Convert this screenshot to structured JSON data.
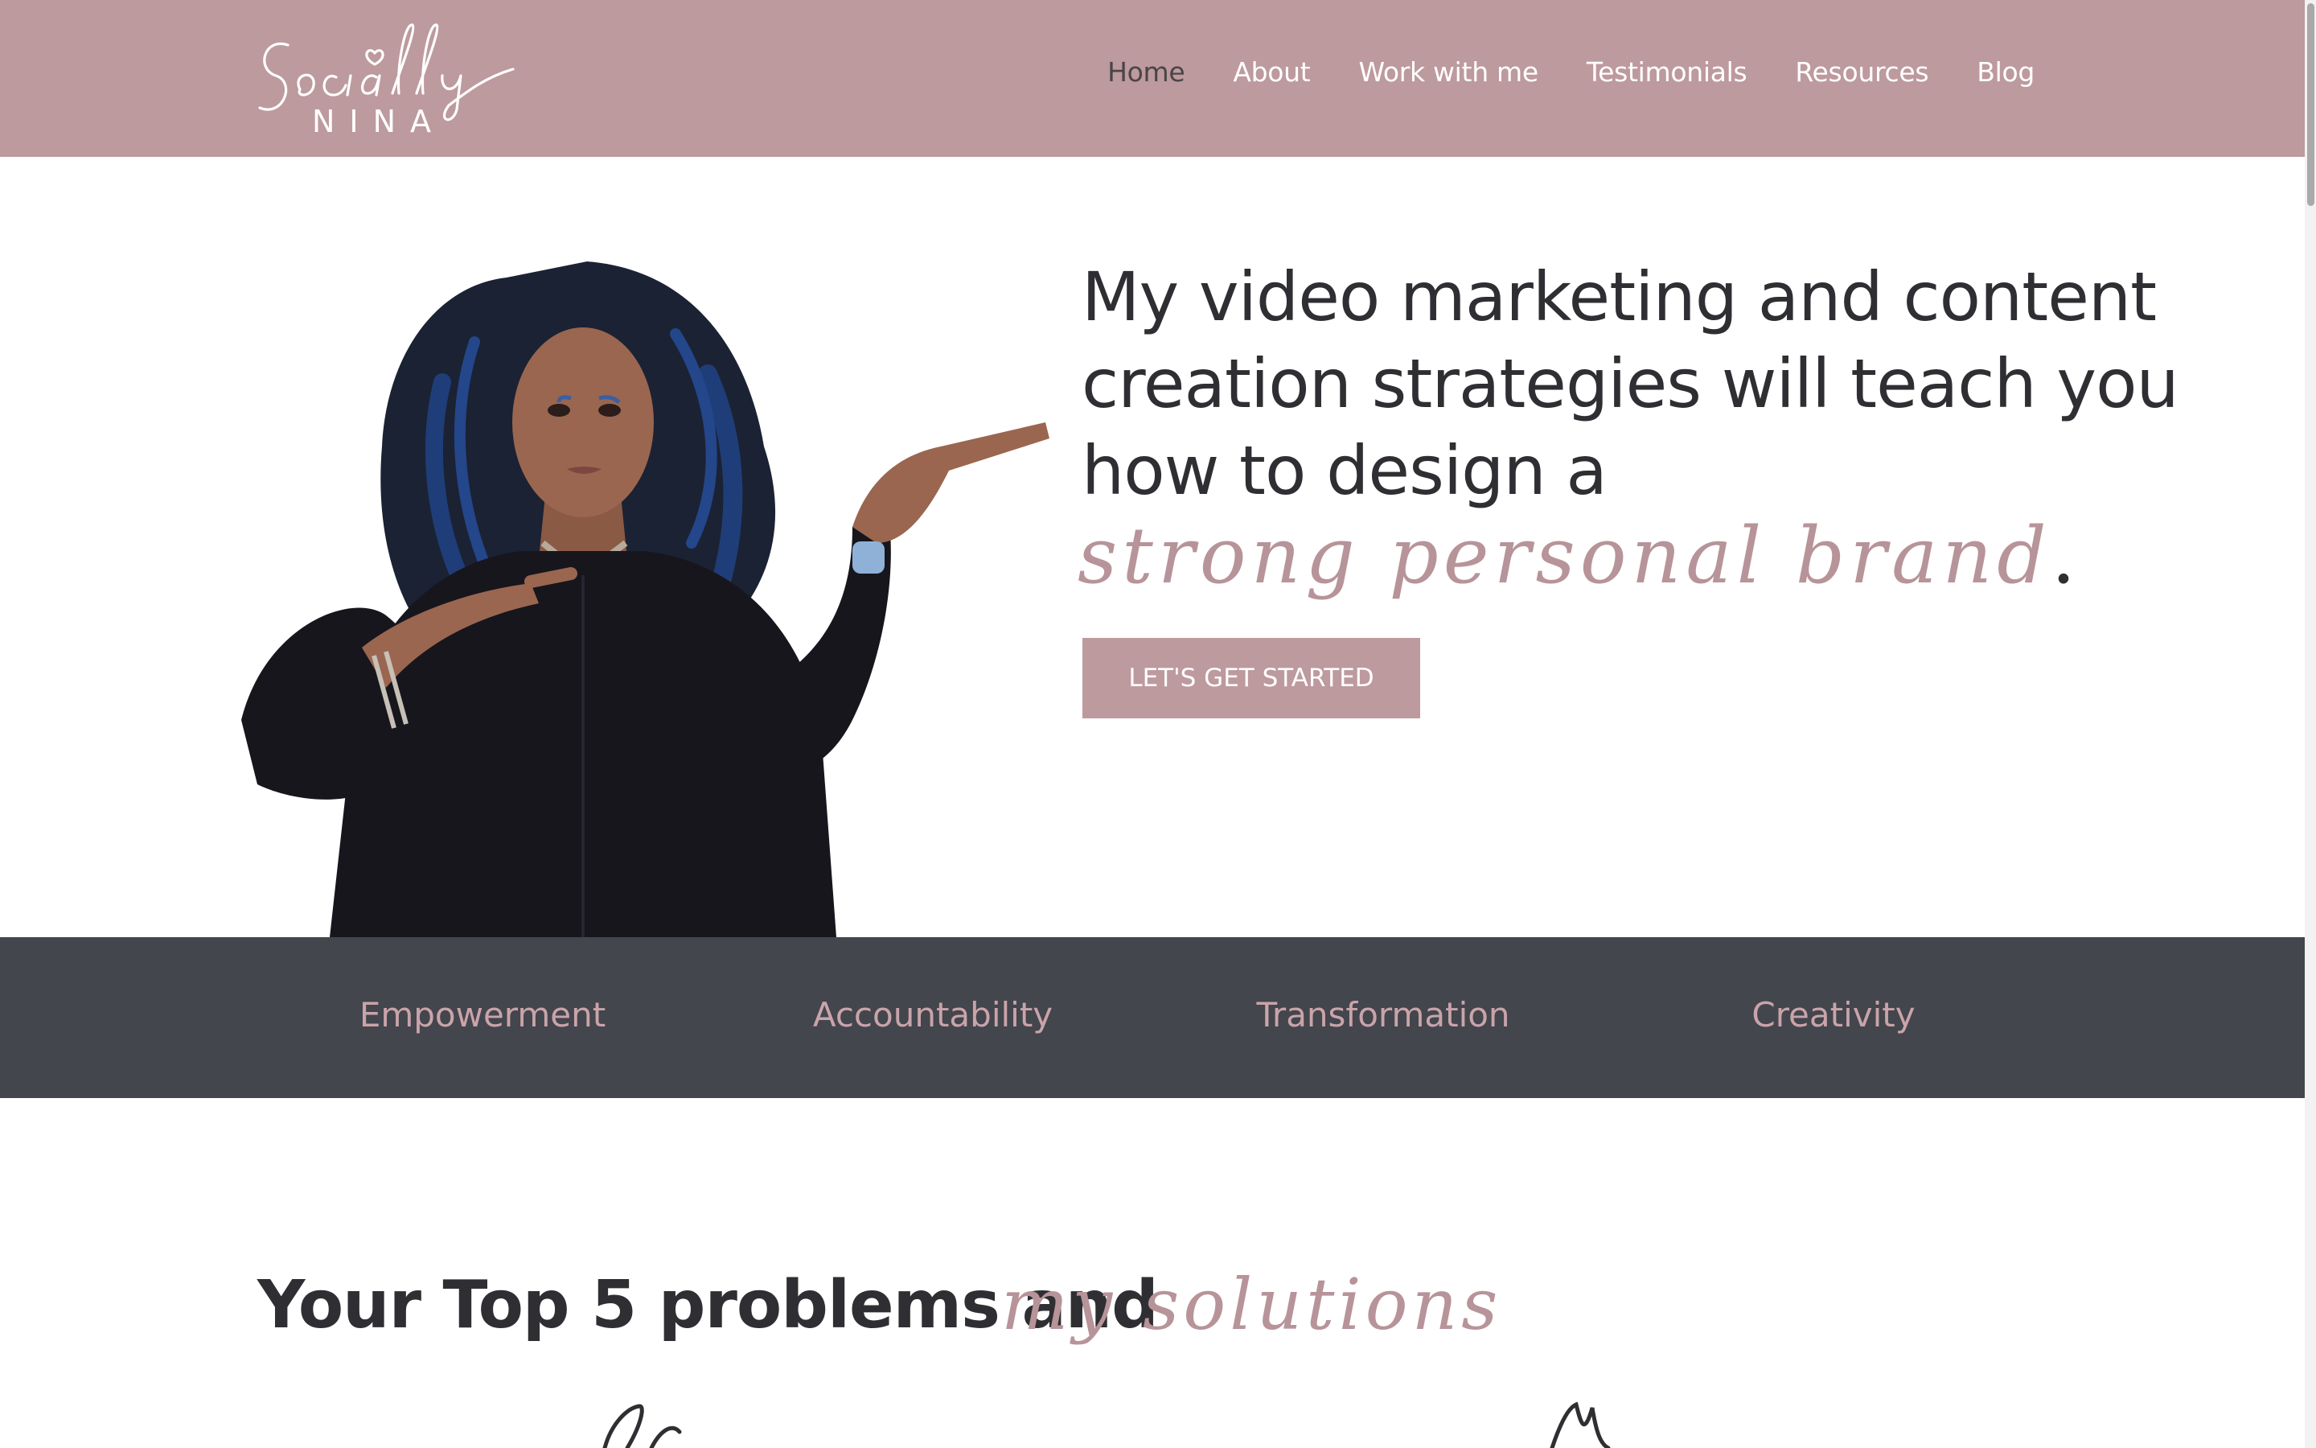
{
  "brand": {
    "logo_script": "Socially",
    "logo_caps": "NINA",
    "accent_color": "#bd9a9e",
    "dark_band_color": "#43464c"
  },
  "nav": {
    "items": [
      {
        "label": "Home",
        "active": true
      },
      {
        "label": "About"
      },
      {
        "label": "Work with me"
      },
      {
        "label": "Testimonials"
      },
      {
        "label": "Resources"
      },
      {
        "label": "Blog"
      }
    ]
  },
  "hero": {
    "headline_lines": [
      "My video marketing and content",
      "creation strategies will teach you",
      "how to design a"
    ],
    "script_phrase": "strong personal brand",
    "script_punct": ".",
    "cta_label": "LET'S GET STARTED",
    "photo_alt": "woman-pointing-photo"
  },
  "values": [
    "Empowerment",
    "Accountability",
    "Transformation",
    "Creativity"
  ],
  "problems": {
    "title": "Your Top 5 problems and",
    "script": "my solutions"
  }
}
